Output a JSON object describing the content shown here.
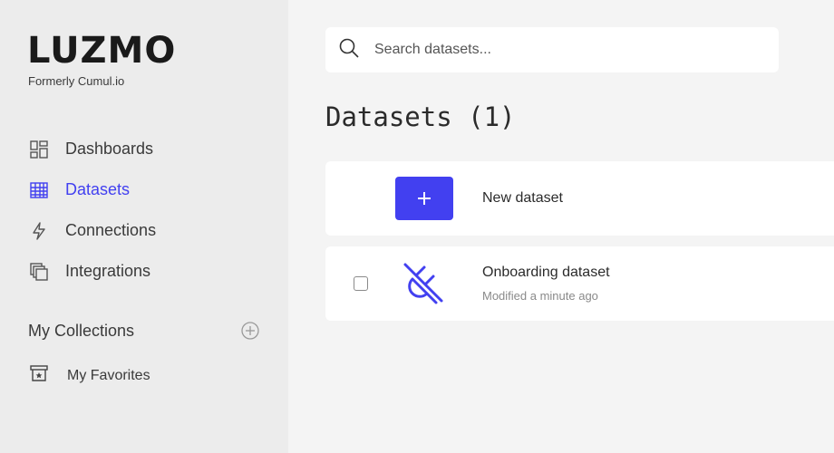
{
  "brand": {
    "logo_text": "LUZMO",
    "subtitle": "Formerly Cumul.io",
    "accent_color": "#4240f0"
  },
  "sidebar": {
    "items": [
      {
        "label": "Dashboards",
        "icon": "dashboard-icon",
        "active": false
      },
      {
        "label": "Datasets",
        "icon": "table-icon",
        "active": true
      },
      {
        "label": "Connections",
        "icon": "lightning-icon",
        "active": false
      },
      {
        "label": "Integrations",
        "icon": "stacked-squares-icon",
        "active": false
      }
    ],
    "collections_title": "My Collections",
    "favorites_label": "My Favorites"
  },
  "search": {
    "placeholder": "Search datasets..."
  },
  "main": {
    "title": "Datasets (1)",
    "new_button_symbol": "+",
    "new_label": "New dataset",
    "datasets": [
      {
        "name": "Onboarding dataset",
        "modified": "Modified a minute ago",
        "icon": "plug-icon"
      }
    ]
  }
}
